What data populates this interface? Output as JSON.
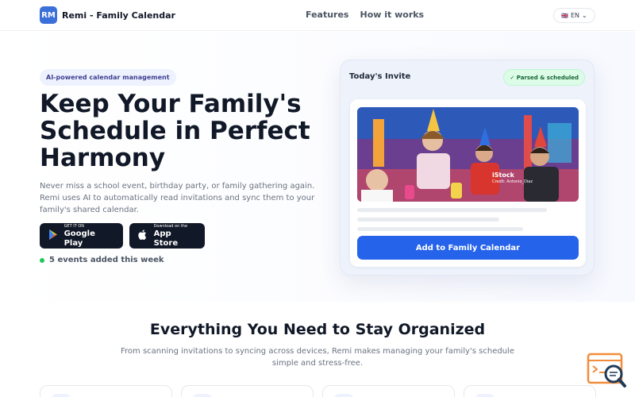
{
  "header": {
    "logo_text": "RM",
    "brand": "Remi - Family Calendar",
    "nav": [
      "Features",
      "How it works"
    ],
    "lang_flag": "🇬🇧",
    "lang_label": "EN",
    "lang_chevron": "⌄"
  },
  "hero": {
    "badge": "AI-powered calendar management",
    "title": "Keep Your Family's Schedule in Perfect Harmony",
    "subtitle": "Never miss a school event, birthday party, or family gathering again. Remi uses AI to automatically read invitations and sync them to your family's shared calendar.",
    "google_play": {
      "small": "GET IT ON",
      "big": "Google Play",
      "icon": "play-icon"
    },
    "app_store": {
      "small": "Download on the",
      "big": "App Store",
      "icon": "apple-icon"
    },
    "events_text": "5 events added this week",
    "events_dot_color": "#22c55e"
  },
  "invite_card": {
    "title": "Today's Invite",
    "status": "✓ Parsed & scheduled",
    "photo_watermark": "iStock",
    "photo_credit": "Credit: Antonio_Diaz",
    "button": "Add to Family Calendar"
  },
  "features": {
    "title": "Everything You Need to Stay Organized",
    "subtitle": "From scanning invitations to syncing across devices, Remi makes managing your family's schedule simple and stress-free."
  },
  "colors": {
    "accent": "#2563eb",
    "logo": "#3b6fd9",
    "success": "#22c55e",
    "dark_button": "#111827"
  }
}
